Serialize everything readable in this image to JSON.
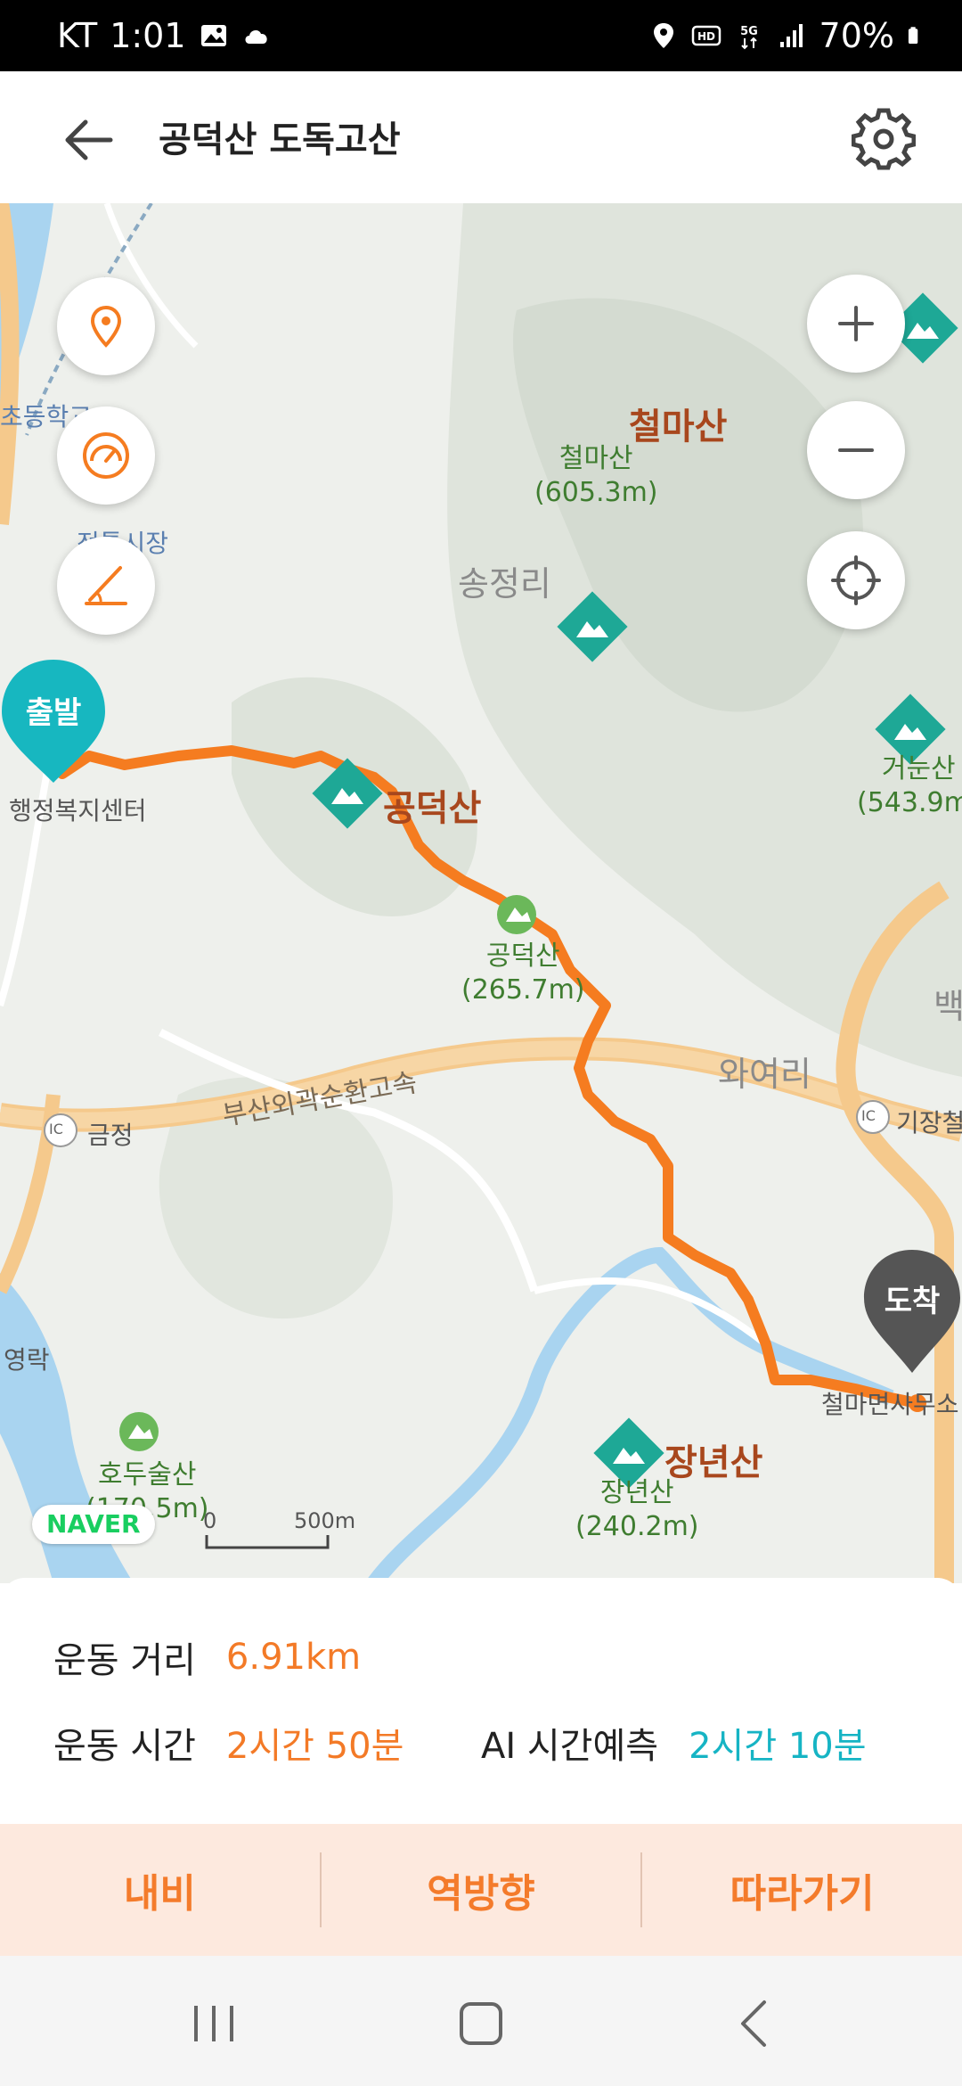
{
  "status_bar": {
    "carrier": "KT",
    "time": "1:01",
    "battery": "70%"
  },
  "header": {
    "title": "공덕산 도독고산"
  },
  "map": {
    "peaks": [
      {
        "name": "철마산",
        "sub": "철마산",
        "elevation": "(605.3m)"
      },
      {
        "name": "공덕산"
      },
      {
        "sub": "공덕산",
        "elevation": "(265.7m)"
      },
      {
        "name": "장년산",
        "sub": "장년산",
        "elevation": "(240.2m)"
      },
      {
        "sub": "거눈산",
        "elevation": "(543.9m)"
      },
      {
        "sub": "호두술산",
        "elevation": "(170.5m)"
      }
    ],
    "places": {
      "songjeong": "송정리",
      "wayeo": "와여리",
      "geumjeong": "금정",
      "gijang": "기장철",
      "cheolma_office": "철마면사무소",
      "yeongrak": "영락",
      "hangjeong": "행정복지센터",
      "school": "초등학교",
      "market": "전통시장",
      "baek": "백"
    },
    "road_label": "부산외곽순환고속",
    "start_marker": "출발",
    "end_marker": "도착",
    "scale": {
      "zero": "0",
      "length": "500m"
    },
    "naver_logo": "NAVER",
    "ic": "IC"
  },
  "stats": {
    "distance_label": "운동 거리",
    "distance_value": "6.91km",
    "time_label": "운동 시간",
    "time_value": "2시간 50분",
    "ai_label": "AI 시간예측",
    "ai_value": "2시간 10분"
  },
  "actions": {
    "nav": "내비",
    "reverse": "역방향",
    "follow": "따라가기"
  },
  "colors": {
    "route": "#f57c20",
    "accent_orange": "#f37a27",
    "accent_teal": "#16b4c4",
    "start_pin": "#17b7c0",
    "end_pin": "#555555",
    "peak_icon": "#1ea896"
  }
}
